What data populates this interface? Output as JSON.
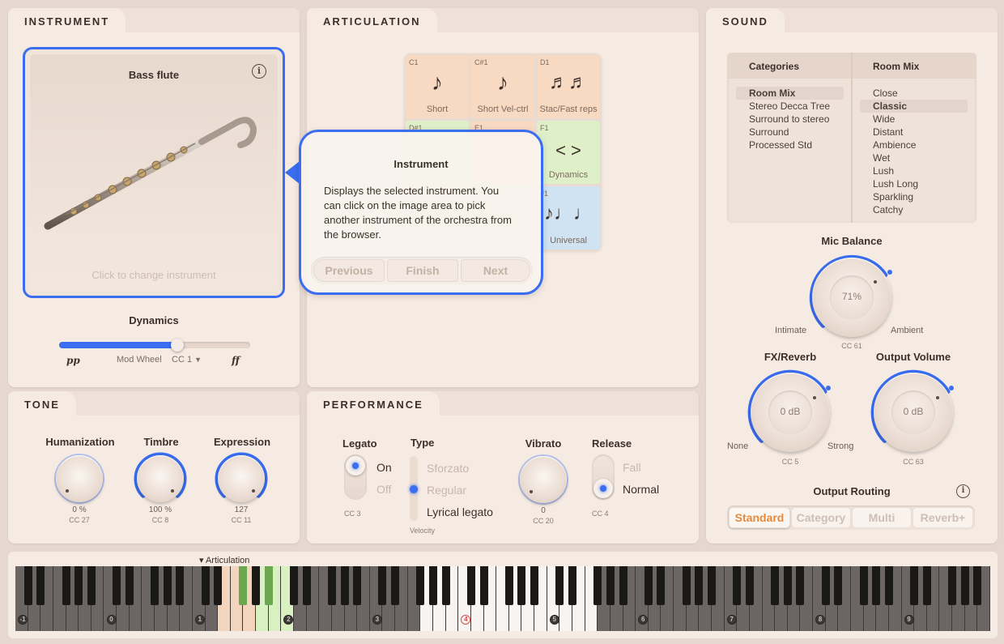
{
  "panels": {
    "instrument": "INSTRUMENT",
    "articulation": "ARTICULATION",
    "sound": "SOUND",
    "tone": "TONE",
    "performance": "PERFORMANCE"
  },
  "instrument": {
    "name": "Bass flute",
    "change_hint": "Click to change instrument",
    "info_icon": "info-icon"
  },
  "dynamics": {
    "label": "Dynamics",
    "min": "pp",
    "max": "ff",
    "source": "Mod Wheel",
    "cc": "CC 1",
    "level": 0.62
  },
  "tooltip": {
    "title": "Instrument",
    "body": "Displays the selected instrument. You can click on the image area to pick another instrument of the orchestra from the browser.",
    "previous": "Previous",
    "finish": "Finish",
    "next": "Next"
  },
  "articulations": [
    {
      "note": "C1",
      "name": "Short",
      "icon": "♪"
    },
    {
      "note": "C#1",
      "name": "Short Vel-ctrl",
      "icon": "♪"
    },
    {
      "note": "D1",
      "name": "Stac/Fast reps",
      "icon": "♬♬"
    },
    {
      "note": "D#1",
      "name": "",
      "icon": ""
    },
    {
      "note": "E1",
      "name": "",
      "icon": ""
    },
    {
      "note": "F1",
      "name": "Dynamics",
      "icon": "< >"
    },
    {
      "note": "#1",
      "name": "Universal",
      "icon": "♪♩♩"
    }
  ],
  "tone": {
    "knobs": [
      {
        "label": "Humanization",
        "value": "0 %",
        "cc": "CC 27"
      },
      {
        "label": "Timbre",
        "value": "100 %",
        "cc": "CC 8"
      },
      {
        "label": "Expression",
        "value": "127",
        "cc": "CC 11"
      }
    ]
  },
  "performance": {
    "legato": {
      "label": "Legato",
      "on": "On",
      "off": "Off",
      "cc": "CC 3"
    },
    "type": {
      "label": "Type",
      "options": [
        "Sforzato",
        "Regular",
        "Lyrical legato"
      ],
      "footer": "Velocity"
    },
    "vibrato": {
      "label": "Vibrato",
      "value": "0",
      "cc": "CC 20"
    },
    "release": {
      "label": "Release",
      "fall": "Fall",
      "normal": "Normal",
      "cc": "CC 4"
    }
  },
  "sound": {
    "categories_header": "Categories",
    "roommix_header": "Room Mix",
    "categories": [
      "Room Mix",
      "Stereo Decca Tree",
      "Surround to stereo",
      "Surround",
      "Processed Std"
    ],
    "roommix": [
      "Close",
      "Classic",
      "Wide",
      "Distant",
      "Ambience",
      "Wet",
      "Lush",
      "Lush Long",
      "Sparkling",
      "Catchy"
    ],
    "mic_balance": {
      "label": "Mic Balance",
      "value": "71%",
      "left": "Intimate",
      "right": "Ambient",
      "cc": "CC 61"
    },
    "fx_reverb": {
      "label": "FX/Reverb",
      "value": "0 dB",
      "left": "None",
      "right": "Strong",
      "cc": "CC 5"
    },
    "output_volume": {
      "label": "Output Volume",
      "value": "0 dB",
      "cc": "CC 63"
    },
    "routing": {
      "label": "Output Routing",
      "options": [
        "Standard",
        "Category",
        "Multi",
        "Reverb+"
      ]
    }
  },
  "keyboard": {
    "articulation_label": "▾ Articulation",
    "octaves": [
      "-1",
      "0",
      "1",
      "2",
      "3",
      "4",
      "5",
      "6",
      "7",
      "8",
      "9"
    ]
  },
  "colors": {
    "accent": "#3a6df0",
    "active_orange": "#e8893c",
    "art_orange": "#f8d9c2",
    "art_green": "#dff0c9",
    "art_blue": "#cfe3f2"
  }
}
